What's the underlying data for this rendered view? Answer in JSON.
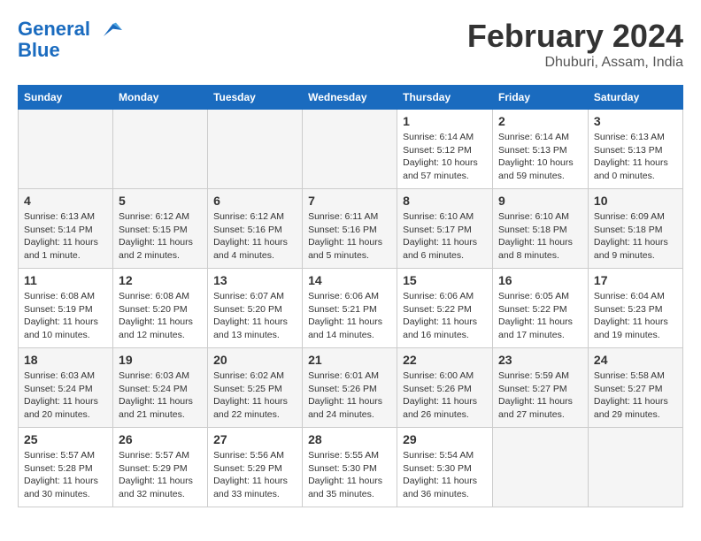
{
  "header": {
    "logo_line1": "General",
    "logo_line2": "Blue",
    "title": "February 2024",
    "subtitle": "Dhuburi, Assam, India"
  },
  "days_of_week": [
    "Sunday",
    "Monday",
    "Tuesday",
    "Wednesday",
    "Thursday",
    "Friday",
    "Saturday"
  ],
  "weeks": [
    [
      {
        "num": "",
        "info": ""
      },
      {
        "num": "",
        "info": ""
      },
      {
        "num": "",
        "info": ""
      },
      {
        "num": "",
        "info": ""
      },
      {
        "num": "1",
        "info": "Sunrise: 6:14 AM\nSunset: 5:12 PM\nDaylight: 10 hours\nand 57 minutes."
      },
      {
        "num": "2",
        "info": "Sunrise: 6:14 AM\nSunset: 5:13 PM\nDaylight: 10 hours\nand 59 minutes."
      },
      {
        "num": "3",
        "info": "Sunrise: 6:13 AM\nSunset: 5:13 PM\nDaylight: 11 hours\nand 0 minutes."
      }
    ],
    [
      {
        "num": "4",
        "info": "Sunrise: 6:13 AM\nSunset: 5:14 PM\nDaylight: 11 hours\nand 1 minute."
      },
      {
        "num": "5",
        "info": "Sunrise: 6:12 AM\nSunset: 5:15 PM\nDaylight: 11 hours\nand 2 minutes."
      },
      {
        "num": "6",
        "info": "Sunrise: 6:12 AM\nSunset: 5:16 PM\nDaylight: 11 hours\nand 4 minutes."
      },
      {
        "num": "7",
        "info": "Sunrise: 6:11 AM\nSunset: 5:16 PM\nDaylight: 11 hours\nand 5 minutes."
      },
      {
        "num": "8",
        "info": "Sunrise: 6:10 AM\nSunset: 5:17 PM\nDaylight: 11 hours\nand 6 minutes."
      },
      {
        "num": "9",
        "info": "Sunrise: 6:10 AM\nSunset: 5:18 PM\nDaylight: 11 hours\nand 8 minutes."
      },
      {
        "num": "10",
        "info": "Sunrise: 6:09 AM\nSunset: 5:18 PM\nDaylight: 11 hours\nand 9 minutes."
      }
    ],
    [
      {
        "num": "11",
        "info": "Sunrise: 6:08 AM\nSunset: 5:19 PM\nDaylight: 11 hours\nand 10 minutes."
      },
      {
        "num": "12",
        "info": "Sunrise: 6:08 AM\nSunset: 5:20 PM\nDaylight: 11 hours\nand 12 minutes."
      },
      {
        "num": "13",
        "info": "Sunrise: 6:07 AM\nSunset: 5:20 PM\nDaylight: 11 hours\nand 13 minutes."
      },
      {
        "num": "14",
        "info": "Sunrise: 6:06 AM\nSunset: 5:21 PM\nDaylight: 11 hours\nand 14 minutes."
      },
      {
        "num": "15",
        "info": "Sunrise: 6:06 AM\nSunset: 5:22 PM\nDaylight: 11 hours\nand 16 minutes."
      },
      {
        "num": "16",
        "info": "Sunrise: 6:05 AM\nSunset: 5:22 PM\nDaylight: 11 hours\nand 17 minutes."
      },
      {
        "num": "17",
        "info": "Sunrise: 6:04 AM\nSunset: 5:23 PM\nDaylight: 11 hours\nand 19 minutes."
      }
    ],
    [
      {
        "num": "18",
        "info": "Sunrise: 6:03 AM\nSunset: 5:24 PM\nDaylight: 11 hours\nand 20 minutes."
      },
      {
        "num": "19",
        "info": "Sunrise: 6:03 AM\nSunset: 5:24 PM\nDaylight: 11 hours\nand 21 minutes."
      },
      {
        "num": "20",
        "info": "Sunrise: 6:02 AM\nSunset: 5:25 PM\nDaylight: 11 hours\nand 22 minutes."
      },
      {
        "num": "21",
        "info": "Sunrise: 6:01 AM\nSunset: 5:26 PM\nDaylight: 11 hours\nand 24 minutes."
      },
      {
        "num": "22",
        "info": "Sunrise: 6:00 AM\nSunset: 5:26 PM\nDaylight: 11 hours\nand 26 minutes."
      },
      {
        "num": "23",
        "info": "Sunrise: 5:59 AM\nSunset: 5:27 PM\nDaylight: 11 hours\nand 27 minutes."
      },
      {
        "num": "24",
        "info": "Sunrise: 5:58 AM\nSunset: 5:27 PM\nDaylight: 11 hours\nand 29 minutes."
      }
    ],
    [
      {
        "num": "25",
        "info": "Sunrise: 5:57 AM\nSunset: 5:28 PM\nDaylight: 11 hours\nand 30 minutes."
      },
      {
        "num": "26",
        "info": "Sunrise: 5:57 AM\nSunset: 5:29 PM\nDaylight: 11 hours\nand 32 minutes."
      },
      {
        "num": "27",
        "info": "Sunrise: 5:56 AM\nSunset: 5:29 PM\nDaylight: 11 hours\nand 33 minutes."
      },
      {
        "num": "28",
        "info": "Sunrise: 5:55 AM\nSunset: 5:30 PM\nDaylight: 11 hours\nand 35 minutes."
      },
      {
        "num": "29",
        "info": "Sunrise: 5:54 AM\nSunset: 5:30 PM\nDaylight: 11 hours\nand 36 minutes."
      },
      {
        "num": "",
        "info": ""
      },
      {
        "num": "",
        "info": ""
      }
    ]
  ]
}
